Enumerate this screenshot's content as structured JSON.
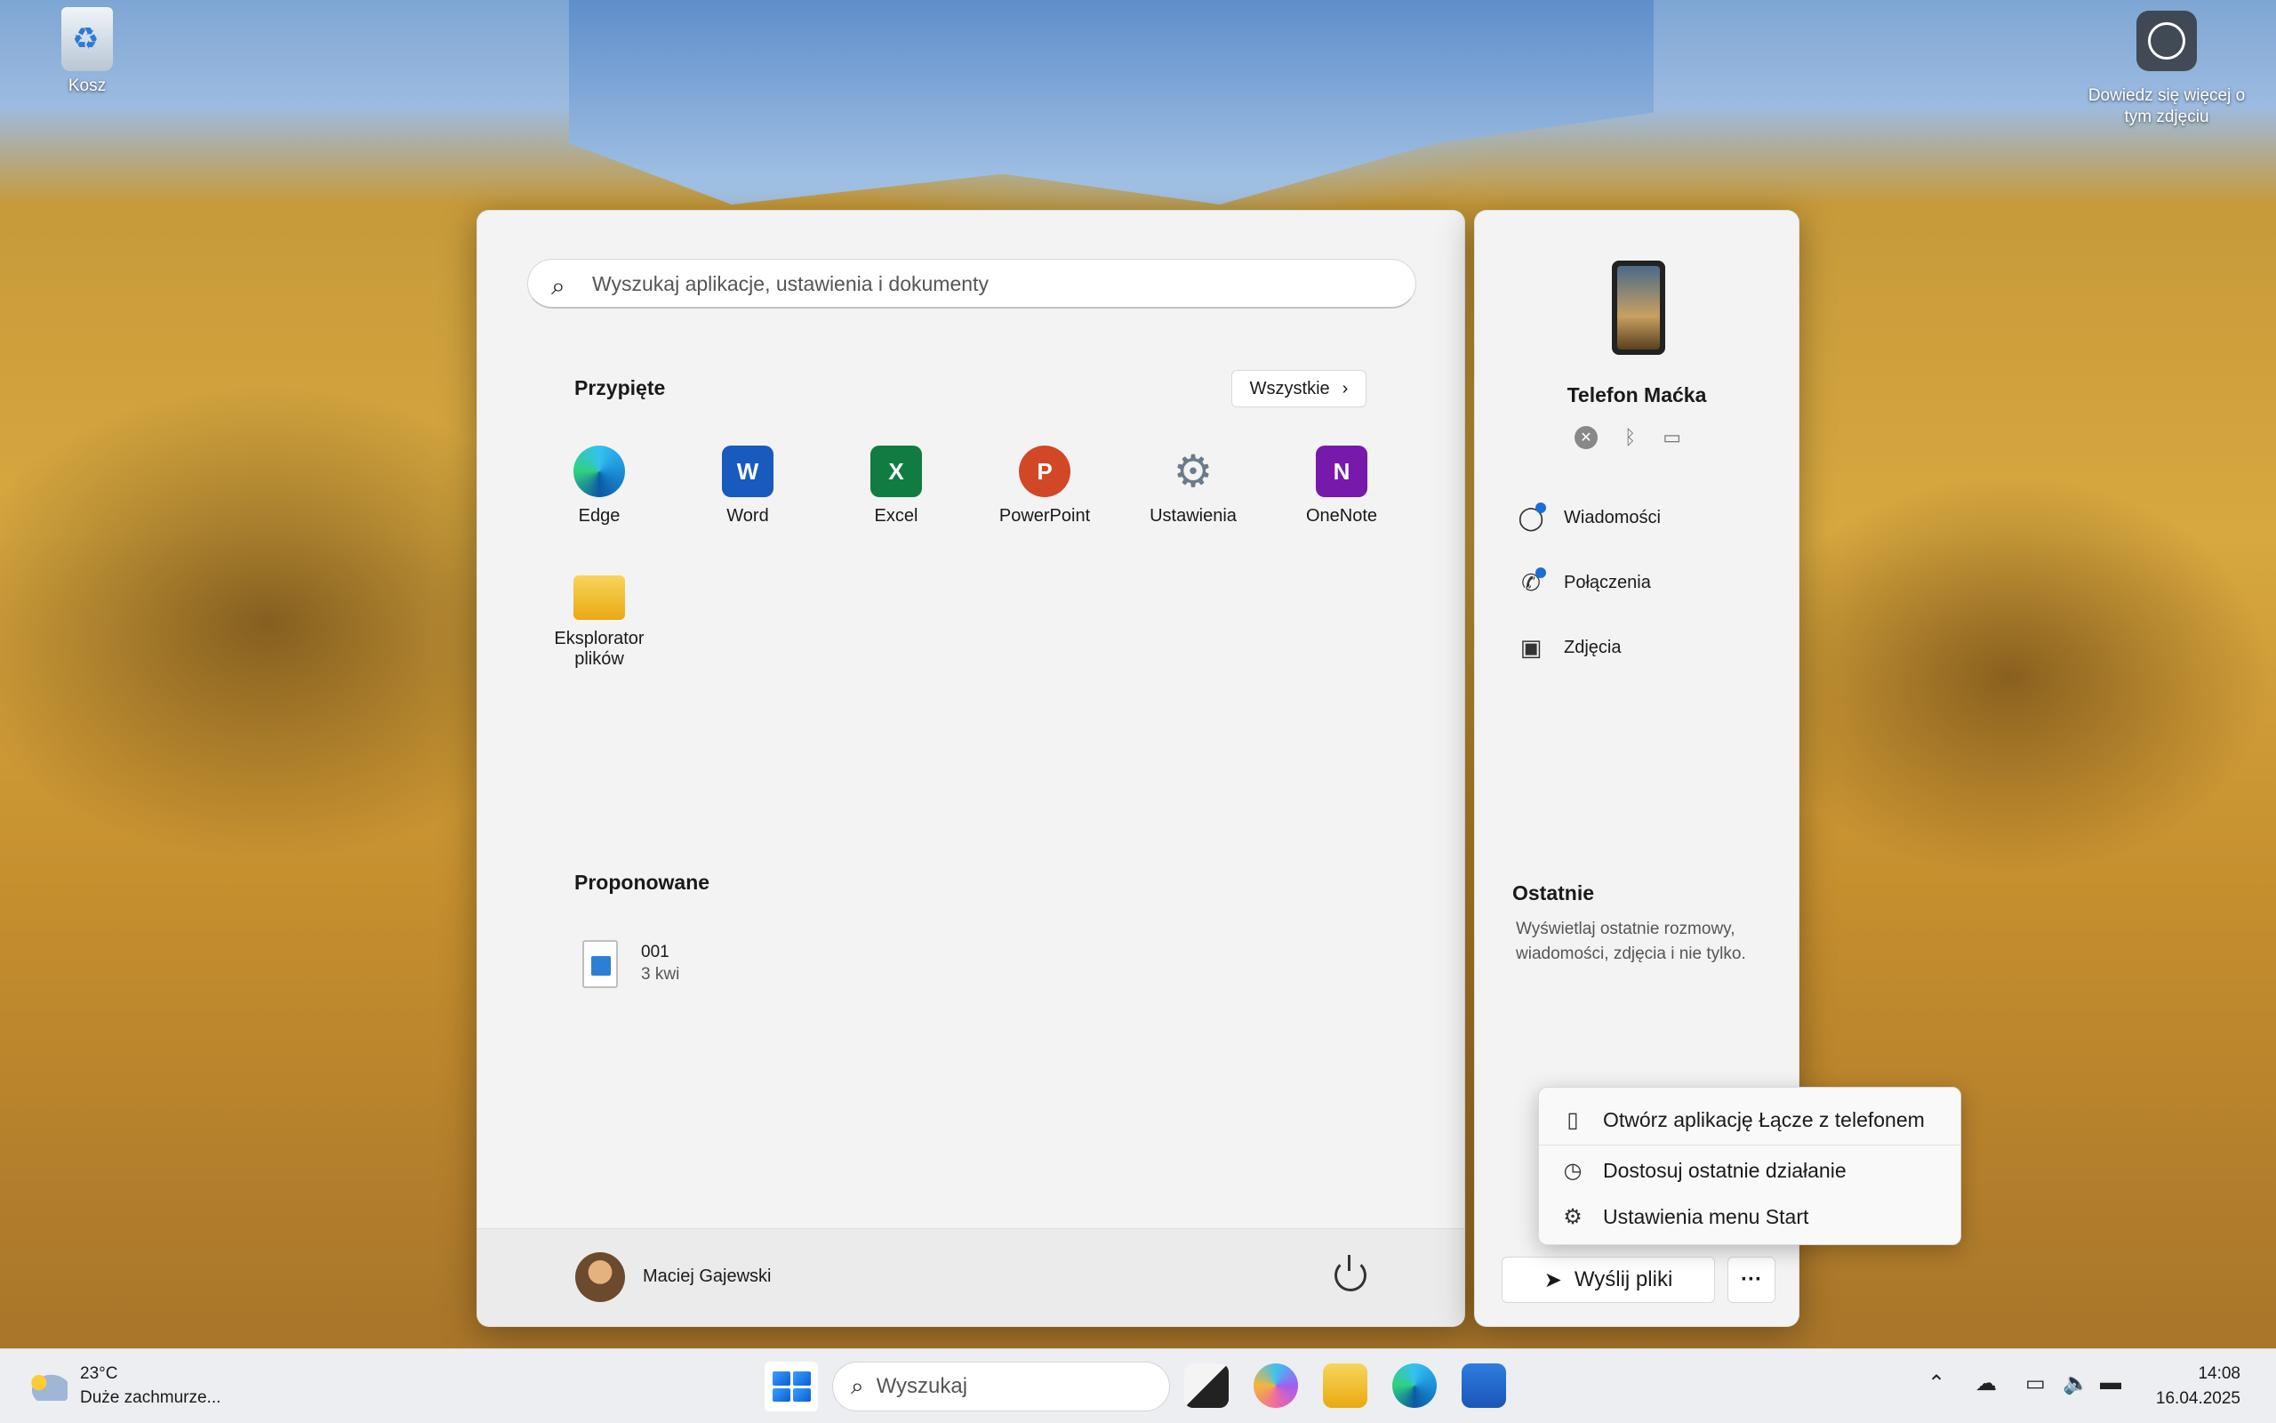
{
  "desktop": {
    "recycle_bin_label": "Kosz",
    "learn_more_label": "Dowiedz się więcej o tym zdjęciu"
  },
  "start": {
    "search_placeholder": "Wyszukaj aplikacje, ustawienia i dokumenty",
    "pinned_title": "Przypięte",
    "all_button": "Wszystkie",
    "pinned_apps": [
      {
        "label": "Edge",
        "color": "#1b8fd8"
      },
      {
        "label": "Word",
        "color": "#185abd"
      },
      {
        "label": "Excel",
        "color": "#107c41"
      },
      {
        "label": "PowerPoint",
        "color": "#d24726"
      },
      {
        "label": "Ustawienia",
        "color": "#6b7b8c"
      },
      {
        "label": "OneNote",
        "color": "#7719aa"
      },
      {
        "label": "Eksplorator plików",
        "color": "#f2c12e"
      }
    ],
    "recommended_title": "Proponowane",
    "recommended": [
      {
        "name": "001",
        "date": "3 kwi"
      }
    ],
    "user_name": "Maciej Gajewski"
  },
  "phone": {
    "name": "Telefon Maćka",
    "items": [
      {
        "label": "Wiadomości",
        "icon": "message-icon"
      },
      {
        "label": "Połączenia",
        "icon": "phone-call-icon"
      },
      {
        "label": "Zdjęcia",
        "icon": "photos-icon"
      }
    ],
    "recent_title": "Ostatnie",
    "recent_desc": "Wyświetlaj ostatnie rozmowy, wiadomości, zdjęcia i nie tylko.",
    "send_button": "Wyślij pliki",
    "more_button": "···"
  },
  "context_menu": {
    "items": [
      {
        "label": "Otwórz aplikację Łącze z telefonem",
        "icon": "phone-link-icon"
      },
      {
        "label": "Dostosuj ostatnie działanie",
        "icon": "clock-icon"
      },
      {
        "label": "Ustawienia menu Start",
        "icon": "gear-icon"
      }
    ]
  },
  "taskbar": {
    "weather_temp": "23°C",
    "weather_desc": "Duże zachmurze...",
    "search_placeholder": "Wyszukaj",
    "time": "14:08",
    "date": "16.04.2025"
  }
}
